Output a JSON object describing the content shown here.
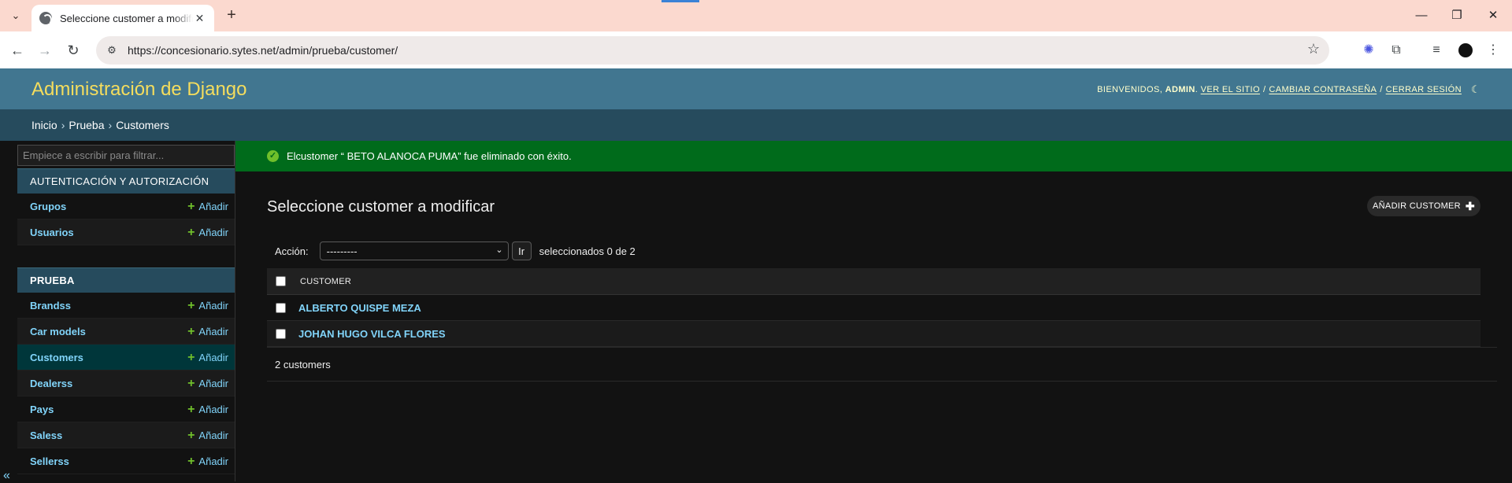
{
  "browser": {
    "tab_title": "Seleccione customer a modificar",
    "url": "https://concesionario.sytes.net/admin/prueba/customer/"
  },
  "header": {
    "brand": "Administración de Django",
    "welcome": "BIENVENIDOS,",
    "user": "ADMIN",
    "view_site": "VER EL SITIO",
    "change_password": "CAMBIAR CONTRASEÑA",
    "logout": "CERRAR SESIÓN",
    "sep": "/"
  },
  "breadcrumbs": {
    "home": "Inicio",
    "app": "Prueba",
    "current": "Customers",
    "sep": "›"
  },
  "sidebar": {
    "filter_placeholder": "Empiece a escribir para filtrar...",
    "add_label": "Añadir",
    "modules": [
      {
        "caption": "AUTENTICACIÓN Y AUTORIZACIÓN",
        "items": [
          "Grupos",
          "Usuarios"
        ]
      },
      {
        "caption": "PRUEBA",
        "items": [
          "Brandss",
          "Car models",
          "Customers",
          "Dealerss",
          "Pays",
          "Saless",
          "Sellerss"
        ]
      }
    ],
    "collapse": "«"
  },
  "message": {
    "text": "Elcustomer “ BETO ALANOCA PUMA” fue eliminado con éxito."
  },
  "content": {
    "title": "Seleccione customer a modificar",
    "add_button": "AÑADIR CUSTOMER",
    "action_label": "Acción:",
    "action_selected": "---------",
    "go_label": "Ir",
    "counter": "seleccionados 0 de 2",
    "column_header": "CUSTOMER",
    "rows": [
      "ALBERTO QUISPE MEZA",
      "JOHAN HUGO VILCA FLORES"
    ],
    "paginator": "2 customers"
  },
  "colors": {
    "header": "#417690",
    "breadcrumbs": "#264b5d",
    "brand": "#f5dd5d",
    "success": "#006b1b",
    "link": "#81d4fa",
    "add_plus": "#70bf2b"
  }
}
